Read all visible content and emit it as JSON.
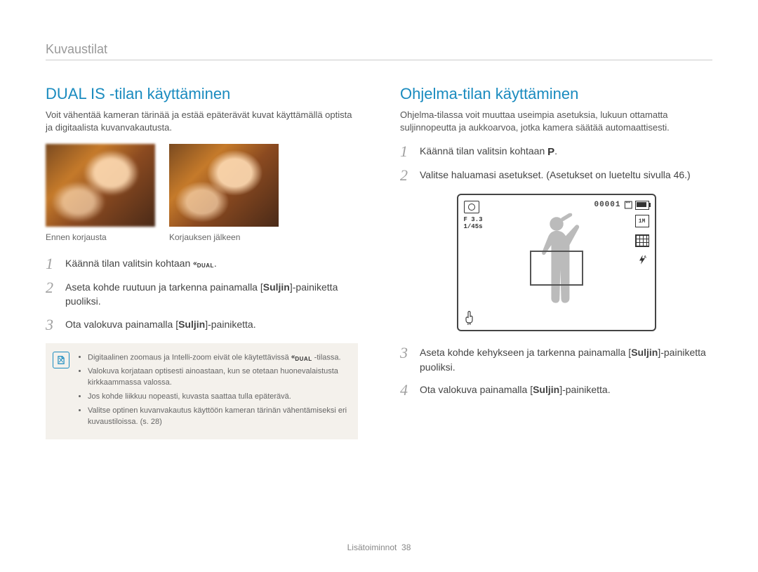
{
  "breadcrumb": "Kuvaustilat",
  "left": {
    "title": "DUAL IS -tilan käyttäminen",
    "intro": "Voit vähentää kameran tärinää ja estää epäterävät kuvat käyttämällä optista ja digitaalista kuvanvakautusta.",
    "caption_before": "Ennen korjausta",
    "caption_after": "Korjauksen jälkeen",
    "step1_a": "Käännä tilan valitsin kohtaan ",
    "step1_b": ".",
    "step2_a": "Aseta kohde ruutuun ja tarkenna painamalla [",
    "step2_bold": "Suljin",
    "step2_b": "]-painiketta puoliksi.",
    "step3_a": "Ota valokuva painamalla [",
    "step3_bold": "Suljin",
    "step3_b": "]-painiketta.",
    "note1_a": "Digitaalinen zoomaus ja Intelli-zoom eivät ole käytettävissä ",
    "note1_b": " -tilassa.",
    "note2": "Valokuva korjataan optisesti ainoastaan, kun se otetaan huonevalaistusta kirkkaammassa valossa.",
    "note3": "Jos kohde liikkuu nopeasti, kuvasta saattaa tulla epäterävä.",
    "note4": "Valitse optinen kuvanvakautus käyttöön kameran tärinän vähentämiseksi eri kuvaustiloissa. (s. 28)"
  },
  "right": {
    "title": "Ohjelma-tilan käyttäminen",
    "intro": "Ohjelma-tilassa voit muuttaa useimpia asetuksia, lukuun ottamatta suljinnopeutta ja aukkoarvoa, jotka kamera säätää automaattisesti.",
    "step1_a": "Käännä tilan valitsin kohtaan ",
    "step1_b": ".",
    "step2": "Valitse haluamasi asetukset. (Asetukset on lueteltu sivulla 46.)",
    "step3_a": "Aseta kohde kehykseen ja tarkenna painamalla [",
    "step3_bold": "Suljin",
    "step3_b": "]-painiketta puoliksi.",
    "step4_a": "Ota valokuva painamalla [",
    "step4_bold": "Suljin",
    "step4_b": "]-painiketta."
  },
  "lcd": {
    "fnumber": "F 3.3",
    "shutter": "1/45s",
    "counter": "00001",
    "size": "1M",
    "flash_sup": "A",
    "is_label": "IS"
  },
  "footer_label": "Lisätoiminnot",
  "footer_page": "38",
  "icons": {
    "dual": "DUAL",
    "p": "P"
  }
}
